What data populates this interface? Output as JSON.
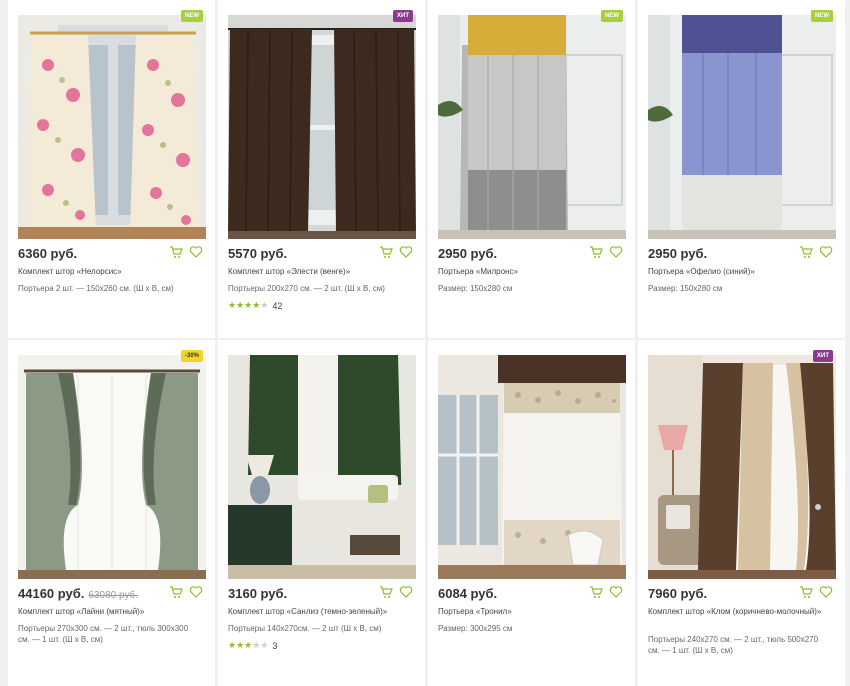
{
  "colors": {
    "accent": "#8cbf2e",
    "new_badge": "#a8cf3d",
    "hit_badge": "#8b3a8e",
    "sale_badge": "#f0d62c"
  },
  "products": [
    {
      "price": "6360 руб.",
      "old_price": "",
      "name": "Комплект штор «Нелорсис»",
      "desc": "Портьера 2 шт. — 150x260 см. (Ш x В, см)",
      "badge": "NEW",
      "rating": "",
      "rating_count": ""
    },
    {
      "price": "5570 руб.",
      "old_price": "",
      "name": "Комплект штор «Элести (венге)»",
      "desc": "Портьеры 200x270 см. — 2 шт. (Ш x В, см)",
      "badge": "ХИТ",
      "rating": "4.5",
      "rating_count": "42"
    },
    {
      "price": "2950 руб.",
      "old_price": "",
      "name": "Портьера «Милронс»",
      "desc": "Размер: 150x280 см",
      "badge": "NEW",
      "rating": "",
      "rating_count": ""
    },
    {
      "price": "2950 руб.",
      "old_price": "",
      "name": "Портьера «Офелио (синий)»",
      "desc": "Размер: 150x280 см",
      "badge": "NEW",
      "rating": "",
      "rating_count": ""
    },
    {
      "price": "44160 руб.",
      "old_price": "63080 руб.",
      "name": "Комплект штор «Лайни (мятный)»",
      "desc": "Портьеры 270x300 см. — 2 шт., тюль 300x300 см. — 1 шт. (Ш x В, см)",
      "badge": "-30%",
      "rating": "",
      "rating_count": ""
    },
    {
      "price": "3160 руб.",
      "old_price": "",
      "name": "Комплект штор «Санлиз (темно-зеленый)»",
      "desc": "Портьеры 140x270см. — 2 шт (Ш x В, см)",
      "badge": "",
      "rating": "3",
      "rating_count": "3"
    },
    {
      "price": "6084 руб.",
      "old_price": "",
      "name": "Портьера «Тронил»",
      "desc": "Размер: 300x295 см",
      "badge": "",
      "rating": "",
      "rating_count": ""
    },
    {
      "price": "7960 руб.",
      "old_price": "",
      "name": "Комплект штор «Клом (коричнево-молочный)»",
      "desc": "Портьеры 240x270 см. — 2 шт., тюль 500x270 см. — 1 шт. (Ш x В, см)",
      "badge": "ХИТ",
      "rating": "",
      "rating_count": ""
    }
  ],
  "icons": {
    "cart": "cart-icon",
    "favorite": "heart-icon"
  }
}
